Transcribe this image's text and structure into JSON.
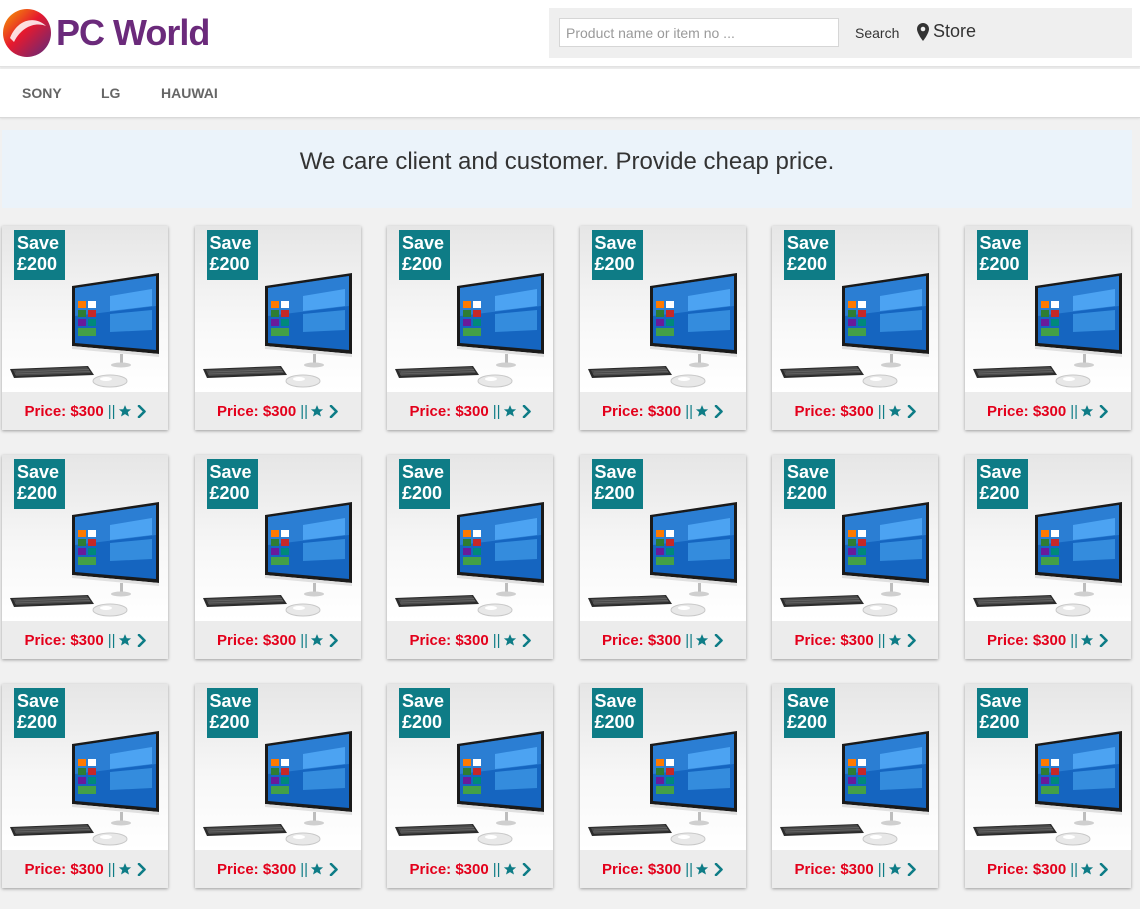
{
  "header": {
    "brand": "PC World",
    "search": {
      "placeholder": "Product name or item no ...",
      "value": ""
    },
    "search_label": "Search",
    "store_label": "Store"
  },
  "nav": {
    "items": [
      "SONY",
      "LG",
      "HAUWAI"
    ]
  },
  "banner": {
    "text": "We care client and customer. Provide cheap price."
  },
  "colors": {
    "brand_purple": "#6b2a7b",
    "badge_teal": "#0e7c86",
    "price_red": "#e3001b"
  },
  "products": [
    {
      "badge_line1": "Save",
      "badge_line2": "£200",
      "price": "Price: $300",
      "separator": "||"
    },
    {
      "badge_line1": "Save",
      "badge_line2": "£200",
      "price": "Price: $300",
      "separator": "||"
    },
    {
      "badge_line1": "Save",
      "badge_line2": "£200",
      "price": "Price: $300",
      "separator": "||"
    },
    {
      "badge_line1": "Save",
      "badge_line2": "£200",
      "price": "Price: $300",
      "separator": "||"
    },
    {
      "badge_line1": "Save",
      "badge_line2": "£200",
      "price": "Price: $300",
      "separator": "||"
    },
    {
      "badge_line1": "Save",
      "badge_line2": "£200",
      "price": "Price: $300",
      "separator": "||"
    },
    {
      "badge_line1": "Save",
      "badge_line2": "£200",
      "price": "Price: $300",
      "separator": "||"
    },
    {
      "badge_line1": "Save",
      "badge_line2": "£200",
      "price": "Price: $300",
      "separator": "||"
    },
    {
      "badge_line1": "Save",
      "badge_line2": "£200",
      "price": "Price: $300",
      "separator": "||"
    },
    {
      "badge_line1": "Save",
      "badge_line2": "£200",
      "price": "Price: $300",
      "separator": "||"
    },
    {
      "badge_line1": "Save",
      "badge_line2": "£200",
      "price": "Price: $300",
      "separator": "||"
    },
    {
      "badge_line1": "Save",
      "badge_line2": "£200",
      "price": "Price: $300",
      "separator": "||"
    },
    {
      "badge_line1": "Save",
      "badge_line2": "£200",
      "price": "Price: $300",
      "separator": "||"
    },
    {
      "badge_line1": "Save",
      "badge_line2": "£200",
      "price": "Price: $300",
      "separator": "||"
    },
    {
      "badge_line1": "Save",
      "badge_line2": "£200",
      "price": "Price: $300",
      "separator": "||"
    },
    {
      "badge_line1": "Save",
      "badge_line2": "£200",
      "price": "Price: $300",
      "separator": "||"
    },
    {
      "badge_line1": "Save",
      "badge_line2": "£200",
      "price": "Price: $300",
      "separator": "||"
    },
    {
      "badge_line1": "Save",
      "badge_line2": "£200",
      "price": "Price: $300",
      "separator": "||"
    }
  ]
}
